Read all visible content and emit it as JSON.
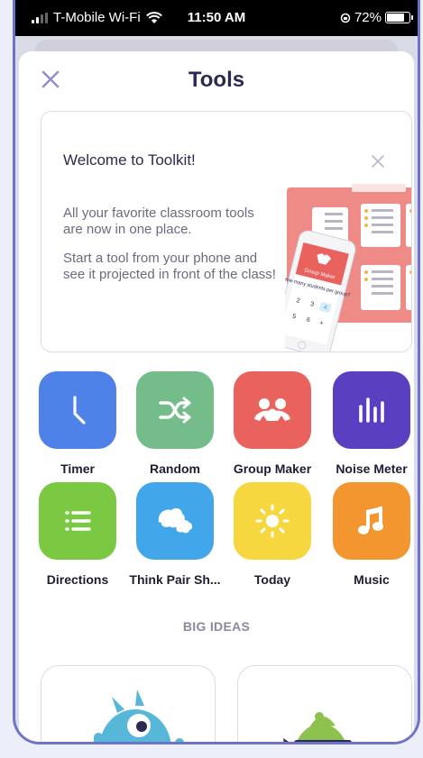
{
  "status": {
    "carrier": "T-Mobile Wi-Fi",
    "time": "11:50 AM",
    "battery": "72%"
  },
  "header": {
    "title": "Tools",
    "close_icon": "close-icon"
  },
  "welcome": {
    "title": "Welcome to Toolkit!",
    "line1": "All your favorite classroom tools are now in one place.",
    "line2": "Start a tool from your phone and see it projected in front of the class!",
    "phone_screen_title": "Group Maker",
    "phone_prompt": "How many students per group?",
    "keypad": [
      "2",
      "3",
      "4",
      "5",
      "6",
      "+"
    ]
  },
  "tools": [
    {
      "label": "Timer",
      "icon": "timer-icon",
      "color": "#4f82e8"
    },
    {
      "label": "Random",
      "icon": "shuffle-icon",
      "color": "#74bc89"
    },
    {
      "label": "Group Maker",
      "icon": "group-icon",
      "color": "#ea625e"
    },
    {
      "label": "Noise Meter",
      "icon": "noise-meter-icon",
      "color": "#5a3fc0"
    },
    {
      "label": "Directions",
      "icon": "list-icon",
      "color": "#7bc943"
    },
    {
      "label": "Think Pair Sh...",
      "icon": "chat-bubbles-icon",
      "color": "#42a7ea"
    },
    {
      "label": "Today",
      "icon": "sun-icon",
      "color": "#f6d73f"
    },
    {
      "label": "Music",
      "icon": "music-note-icon",
      "color": "#f3962f"
    }
  ],
  "big_ideas": {
    "title": "BIG IDEAS"
  },
  "colors": {
    "accent": "#6d74c7",
    "title": "#2c2a50"
  }
}
